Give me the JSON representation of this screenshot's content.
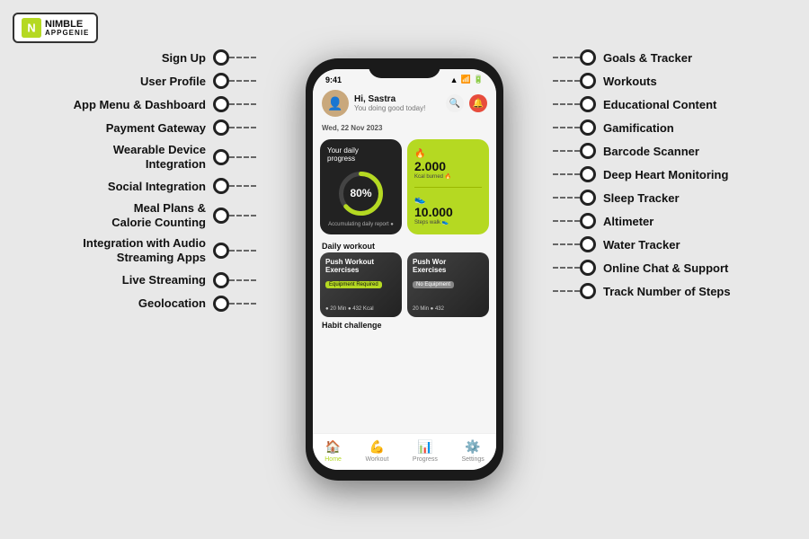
{
  "logo": {
    "text_line1": "NIMBLE",
    "text_line2": "APPGENIE"
  },
  "left_features": [
    {
      "id": "sign-up",
      "label": "Sign Up"
    },
    {
      "id": "user-profile",
      "label": "User Profile"
    },
    {
      "id": "app-menu-dashboard",
      "label": "App Menu & Dashboard"
    },
    {
      "id": "payment-gateway",
      "label": "Payment Gateway"
    },
    {
      "id": "wearable-device",
      "label": "Wearable Device\nIntegration"
    },
    {
      "id": "social-integration",
      "label": "Social Integration"
    },
    {
      "id": "meal-plans",
      "label": "Meal Plans &\nCalorie Counting"
    },
    {
      "id": "audio-streaming",
      "label": "Integration with Audio\nStreaming Apps"
    },
    {
      "id": "live-streaming",
      "label": "Live Streaming"
    },
    {
      "id": "geolocation",
      "label": "Geolocation"
    }
  ],
  "right_features": [
    {
      "id": "goals-tracker",
      "label": "Goals & Tracker"
    },
    {
      "id": "workouts",
      "label": "Workouts"
    },
    {
      "id": "educational-content",
      "label": "Educational Content"
    },
    {
      "id": "gamification",
      "label": "Gamification"
    },
    {
      "id": "barcode-scanner",
      "label": "Barcode Scanner"
    },
    {
      "id": "deep-heart",
      "label": "Deep Heart Monitoring"
    },
    {
      "id": "sleep-tracker",
      "label": "Sleep Tracker"
    },
    {
      "id": "altimeter",
      "label": "Altimeter"
    },
    {
      "id": "water-tracker",
      "label": "Water Tracker"
    },
    {
      "id": "online-chat",
      "label": "Online Chat & Support"
    },
    {
      "id": "track-steps",
      "label": "Track Number of Steps"
    }
  ],
  "phone": {
    "status_time": "9:41",
    "greeting": "Hi, Sastra",
    "sub_greeting": "You doing good today!",
    "date": "Wed, 22 Nov 2023",
    "progress_title": "Your daily\nprogress",
    "progress_percent": "80%",
    "calories_value": "2.000",
    "calories_label": "Kcal burned 🔥",
    "steps_value": "10.000",
    "steps_label": "Steps walk 👟",
    "acc_label": "Accumulating daily report ●",
    "section_workout": "Daily workout",
    "workout1_name": "Push Workout\nExercises",
    "workout1_badge": "Equipment Required",
    "workout1_meta": "● 20 Min  ● 432 Kcal",
    "workout2_name": "Push Wor\nExercises",
    "workout2_badge": "No Equipment",
    "workout2_meta": "20 Min  ● 432",
    "section_habit": "Habit challenge",
    "nav_home": "Home",
    "nav_workout": "Workout",
    "nav_progress": "Progress",
    "nav_settings": "Settings"
  }
}
